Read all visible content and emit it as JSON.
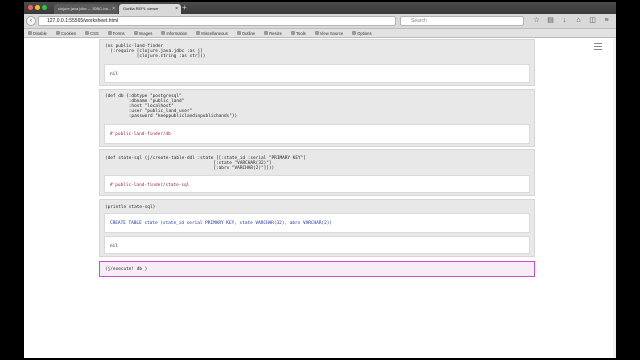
{
  "browser": {
    "tabs": [
      {
        "label": "clojure.java.jdbc -- JDBC-ba..."
      },
      {
        "label": "Gorilla REPL viewer"
      }
    ],
    "url": "127.0.0.1:55565/worksheet.html",
    "search_placeholder": "Search"
  },
  "bookmarks": [
    "Disable",
    "Cookies",
    "CSS",
    "Forms",
    "Images",
    "Information",
    "Miscellaneous",
    "Outline",
    "Resize",
    "Tools",
    "View Source",
    "Options"
  ],
  "cells": [
    {
      "code": [
        "(ns public-land-finder",
        "  (:require [clojure.java.jdbc :as j]",
        "            [clojure.string :as str]))"
      ],
      "output": "nil"
    },
    {
      "code": [
        "(def db {:dbtype \"postgresql\"",
        "         :dbname \"public_land\"",
        "         :host \"localhost\"",
        "         :user \"public_land_user\"",
        "         :password \"keeppubliclandinpublichands\"})"
      ],
      "output": "#'public-land-finder/db"
    },
    {
      "code": [
        "(def state-sql (j/create-table-ddl :state [[:state_id :serial \"PRIMARY KEY\"]",
        "                                         [:state \"VARCHAR(32)\"]",
        "                                         [:abrv \"VARCHAR(2)\"]]))"
      ],
      "output": "#'public-land-finder/state-sql"
    },
    {
      "code": [
        "(println state-sql)"
      ],
      "console": "CREATE TABLE state (state_id serial PRIMARY KEY, state VARCHAR(32), abrv VARCHAR(2))",
      "output": "nil"
    },
    {
      "code": [
        "(j/execute! db )"
      ]
    }
  ]
}
